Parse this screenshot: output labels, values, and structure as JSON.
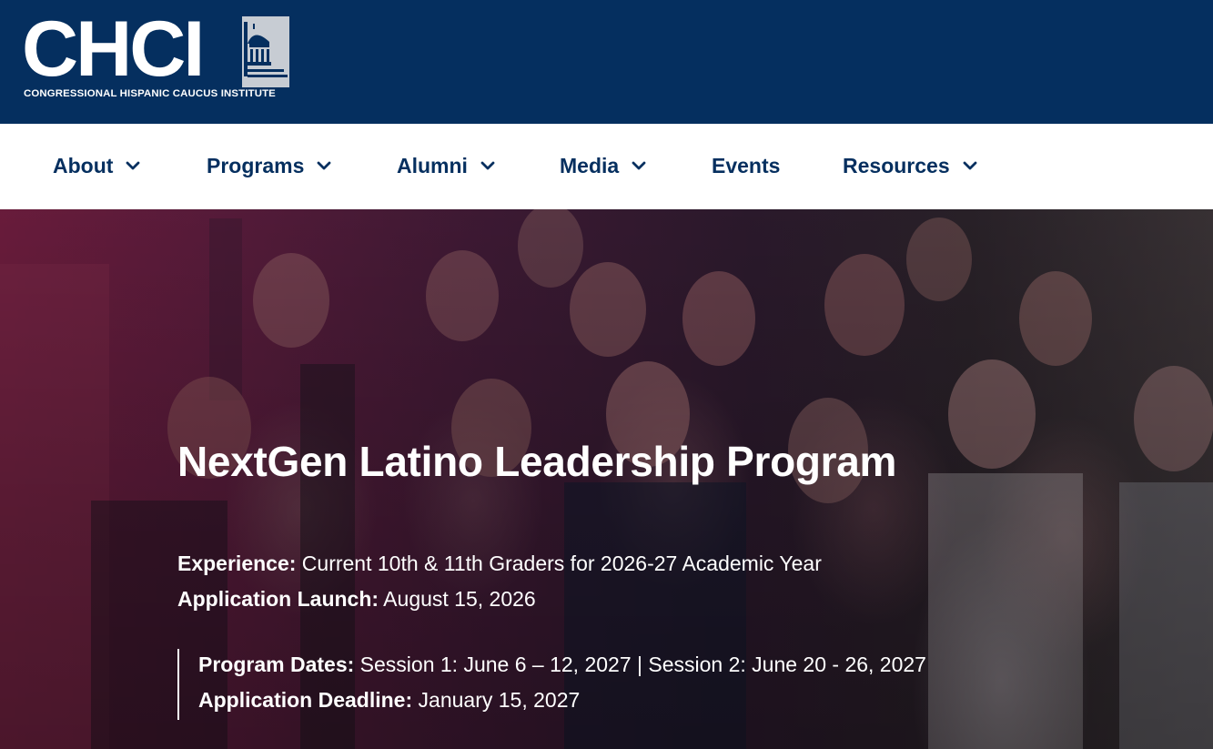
{
  "header": {
    "logo_letters": "CHCI",
    "logo_subtitle": "CONGRESSIONAL HISPANIC CAUCUS INSTITUTE",
    "logo_icon": "capitol-dome-icon",
    "background_color": "#052f5f"
  },
  "nav": {
    "items": [
      {
        "label": "About",
        "has_dropdown": true
      },
      {
        "label": "Programs",
        "has_dropdown": true
      },
      {
        "label": "Alumni",
        "has_dropdown": true
      },
      {
        "label": "Media",
        "has_dropdown": true
      },
      {
        "label": "Events",
        "has_dropdown": false
      },
      {
        "label": "Resources",
        "has_dropdown": true
      }
    ],
    "text_color": "#052f5f"
  },
  "hero": {
    "title": "NextGen Latino Leadership Program",
    "experience_label": "Experience:",
    "experience_value": " Current 10th & 11th Graders for 2026-27 Academic Year",
    "launch_label": "Application Launch:",
    "launch_value": " August 15, 2026",
    "dates_label": "Program Dates:",
    "dates_value": " Session 1: June 6 – 12, 2027 | Session 2: June 20 - 26, 2027",
    "deadline_label": "Application Deadline:",
    "deadline_value": " January 15, 2027",
    "overlay_color": "#6e1d3e"
  }
}
